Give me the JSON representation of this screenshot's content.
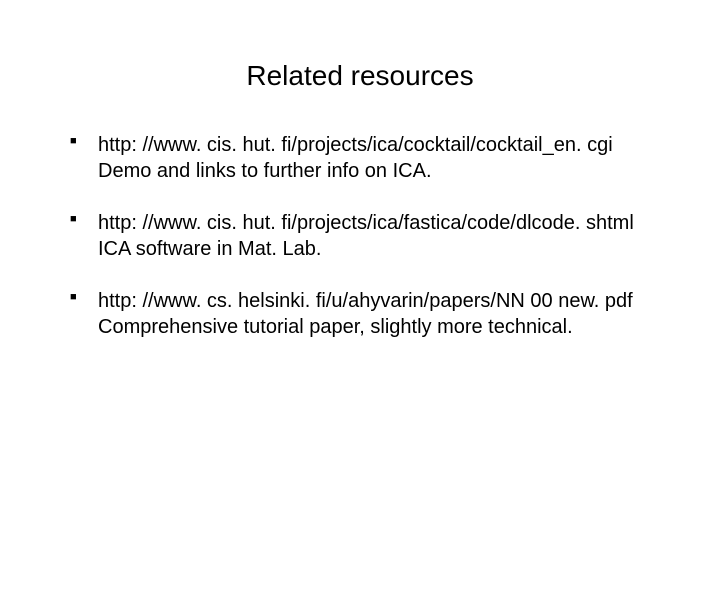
{
  "title": "Related resources",
  "items": [
    {
      "url": "http: //www. cis. hut. fi/projects/ica/cocktail/cocktail_en. cgi",
      "desc": "Demo and links to further  info on ICA."
    },
    {
      "url": "http: //www. cis. hut. fi/projects/ica/fastica/code/dlcode. shtml",
      "desc": "ICA software in Mat. Lab."
    },
    {
      "url": "http: //www. cs. helsinki. fi/u/ahyvarin/papers/NN 00 new. pdf",
      "desc": "Comprehensive tutorial paper, slightly more technical."
    }
  ]
}
